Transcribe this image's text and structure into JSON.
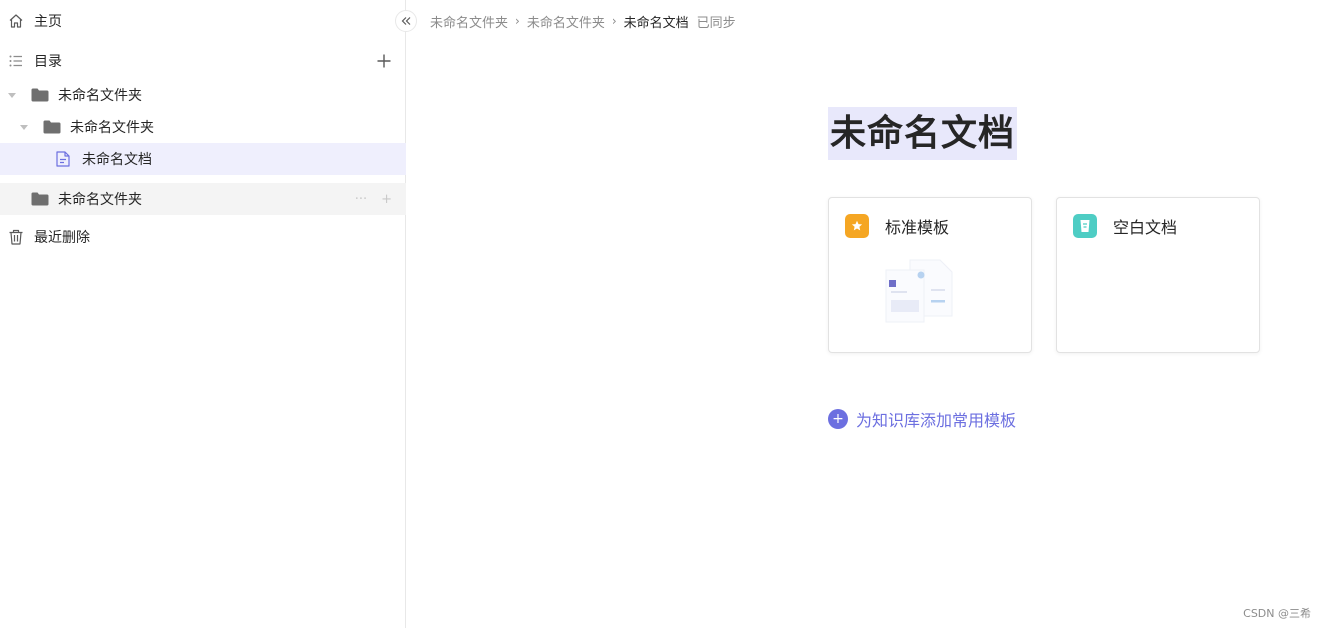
{
  "sidebar": {
    "home_label": "主页",
    "toc_label": "目录",
    "tree": {
      "folder1": "未命名文件夹",
      "folder1_child": "未命名文件夹",
      "doc": "未命名文档",
      "folder2": "未命名文件夹",
      "folder2_actions_more": "···",
      "folder2_actions_add": "+"
    },
    "trash_label": "最近删除"
  },
  "breadcrumb": {
    "items": [
      "未命名文件夹",
      "未命名文件夹",
      "未命名文档"
    ],
    "separator": "›",
    "status": "已同步"
  },
  "document": {
    "title": "未命名文档"
  },
  "templates": {
    "standard_label": "标准模板",
    "blank_label": "空白文档",
    "add_label": "为知识库添加常用模板",
    "add_symbol": "+"
  },
  "watermark": "CSDN @三希",
  "colors": {
    "accent": "#6c6fe0",
    "standard_badge": "#f5a623",
    "blank_badge": "#4ecdc4",
    "selected_row": "#efeffd"
  },
  "icons": {
    "home": "home-icon",
    "toc": "list-icon",
    "add": "plus-icon",
    "collapse": "double-chevron-left-icon",
    "folder": "folder-icon",
    "doc": "document-icon",
    "trash": "trash-icon",
    "star": "star-icon",
    "blank": "blank-doc-icon"
  }
}
